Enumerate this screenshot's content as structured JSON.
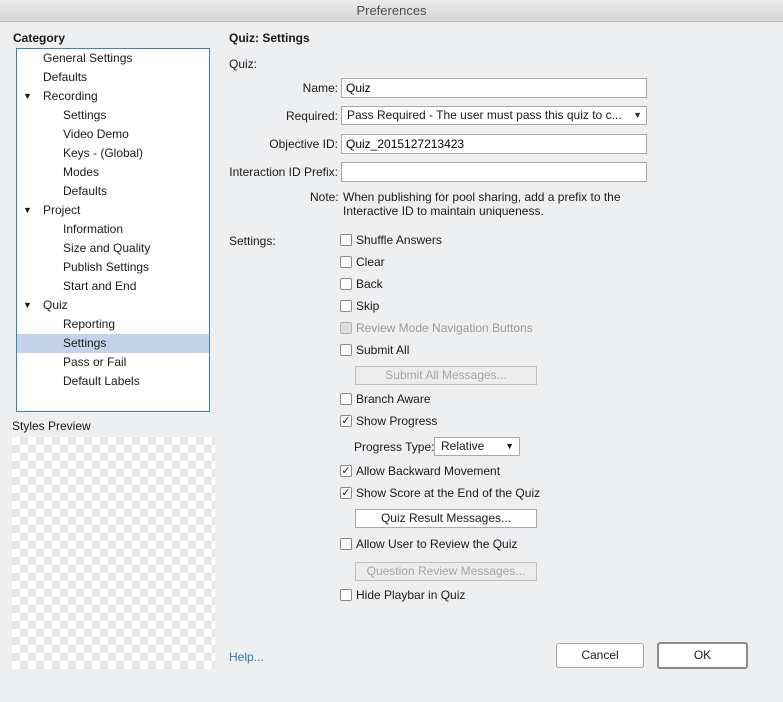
{
  "window": {
    "title": "Preferences"
  },
  "sidebar": {
    "category_label": "Category",
    "items": [
      {
        "label": "General Settings",
        "level": 0,
        "expandable": false
      },
      {
        "label": "Defaults",
        "level": 0,
        "expandable": false
      },
      {
        "label": "Recording",
        "level": 0,
        "expandable": true
      },
      {
        "label": "Settings",
        "level": 1,
        "expandable": false
      },
      {
        "label": "Video Demo",
        "level": 1,
        "expandable": false
      },
      {
        "label": "Keys - (Global)",
        "level": 1,
        "expandable": false
      },
      {
        "label": "Modes",
        "level": 1,
        "expandable": false
      },
      {
        "label": "Defaults",
        "level": 1,
        "expandable": false
      },
      {
        "label": "Project",
        "level": 0,
        "expandable": true
      },
      {
        "label": "Information",
        "level": 1,
        "expandable": false
      },
      {
        "label": "Size and Quality",
        "level": 1,
        "expandable": false
      },
      {
        "label": "Publish Settings",
        "level": 1,
        "expandable": false
      },
      {
        "label": "Start and End",
        "level": 1,
        "expandable": false
      },
      {
        "label": "Quiz",
        "level": 0,
        "expandable": true
      },
      {
        "label": "Reporting",
        "level": 1,
        "expandable": false
      },
      {
        "label": "Settings",
        "level": 1,
        "expandable": false,
        "selected": true
      },
      {
        "label": "Pass or Fail",
        "level": 1,
        "expandable": false
      },
      {
        "label": "Default Labels",
        "level": 1,
        "expandable": false
      }
    ],
    "styles_preview_label": "Styles Preview"
  },
  "main": {
    "section_title": "Quiz: Settings",
    "quiz_label": "Quiz:",
    "name_label": "Name:",
    "name_value": "Quiz",
    "required_label": "Required:",
    "required_value": "Pass Required - The user must pass this quiz to c...",
    "objective_label": "Objective ID:",
    "objective_value": "Quiz_2015127213423",
    "interaction_label": "Interaction ID Prefix:",
    "interaction_value": "",
    "note_label": "Note:",
    "note_text": "When publishing for pool sharing, add a prefix to the Interactive ID to maintain uniqueness.",
    "settings_label": "Settings:",
    "checkboxes": {
      "shuffle": {
        "label": "Shuffle Answers",
        "checked": false
      },
      "clear": {
        "label": "Clear",
        "checked": false
      },
      "back": {
        "label": "Back",
        "checked": false
      },
      "skip": {
        "label": "Skip",
        "checked": false
      },
      "review_nav": {
        "label": "Review Mode Navigation Buttons",
        "checked": false,
        "disabled": true
      },
      "submit_all": {
        "label": "Submit All",
        "checked": false
      },
      "branch_aware": {
        "label": "Branch Aware",
        "checked": false
      },
      "show_progress": {
        "label": "Show Progress",
        "checked": true
      },
      "allow_backward": {
        "label": "Allow Backward Movement",
        "checked": true
      },
      "show_score": {
        "label": "Show Score at the End of the Quiz",
        "checked": true
      },
      "allow_review": {
        "label": "Allow User to Review the Quiz",
        "checked": false
      },
      "hide_playbar": {
        "label": "Hide Playbar in Quiz",
        "checked": false
      }
    },
    "submit_all_messages_label": "Submit All Messages...",
    "progress_type_label": "Progress Type:",
    "progress_type_value": "Relative",
    "quiz_result_messages_label": "Quiz Result Messages...",
    "question_review_messages_label": "Question Review Messages..."
  },
  "footer": {
    "help_label": "Help...",
    "cancel_label": "Cancel",
    "ok_label": "OK"
  },
  "glyphs": {
    "check": "✓",
    "caret_down": "▼"
  },
  "colors": {
    "selection": "#c5d3ea",
    "tree_border": "#3c82c0",
    "link": "#2f74c0"
  }
}
